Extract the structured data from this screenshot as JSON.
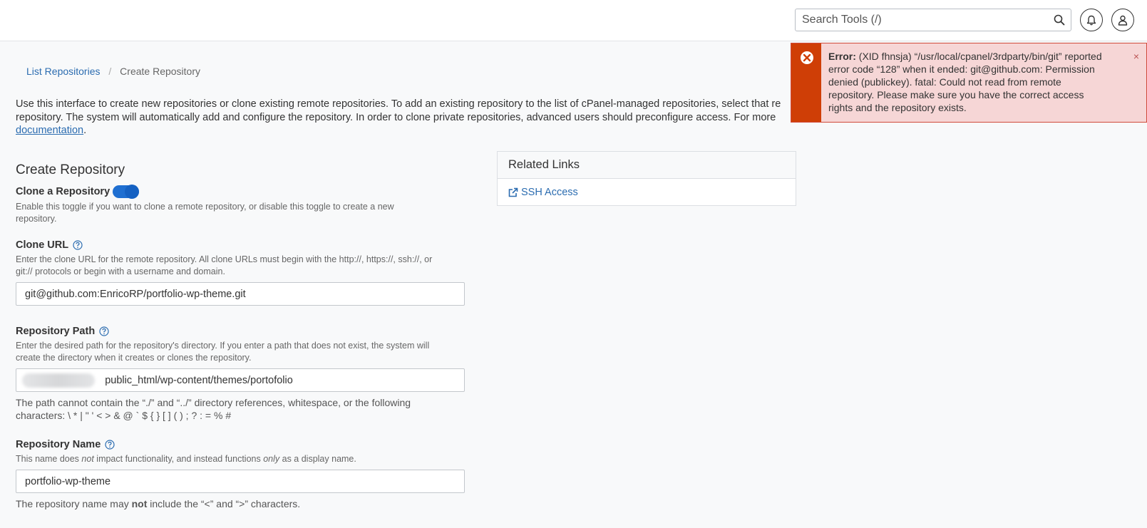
{
  "header": {
    "search_placeholder": "Search Tools (/)",
    "icons": [
      "search-icon",
      "bell-icon",
      "user-icon"
    ]
  },
  "breadcrumb": {
    "link": "List Repositories",
    "separator": "/",
    "current": "Create Repository"
  },
  "intro": {
    "line1": "Use this interface to create new repositories or clone existing remote repositories. To add an existing repository to the list of cPanel-managed repositories, select that re",
    "line2": "repository. The system will automatically add and configure the repository. In order to clone private repositories, advanced users should preconfigure access. For more",
    "link": "documentation",
    "after_link": "."
  },
  "form": {
    "title": "Create Repository",
    "clone_toggle": {
      "label": "Clone a Repository",
      "enabled": true,
      "desc_line1": "Enable this toggle if you want to clone a remote repository, or disable this toggle to create a new",
      "desc_line2": "repository."
    },
    "clone_url": {
      "label": "Clone URL",
      "desc_line1": "Enter the clone URL for the remote repository. All clone URLs must begin with the http://, https://, ssh://, or",
      "desc_line2": "git:// protocols or begin with a username and domain.",
      "value": "git@github.com:EnricoRP/portfolio-wp-theme.git"
    },
    "repo_path": {
      "label": "Repository Path",
      "desc_line1": "Enter the desired path for the repository's directory. If you enter a path that does not exist, the system will",
      "desc_line2": "create the directory when it creates or clones the repository.",
      "value": "public_html/wp-content/themes/portofolio",
      "note_line1": "The path cannot contain the “./” and “../” directory references, whitespace, or the following",
      "note_line2": "characters: \\ * | \" ' < > & @ ` $ { } [ ] ( ) ; ? : = % #"
    },
    "repo_name": {
      "label": "Repository Name",
      "desc_pre": "This name does ",
      "desc_em1": "not",
      "desc_mid": " impact functionality, and instead functions ",
      "desc_em2": "only",
      "desc_post": " as a display name.",
      "value": "portfolio-wp-theme",
      "note_pre": "The repository name may ",
      "note_bold": "not",
      "note_post": " include the “<” and “>” characters."
    }
  },
  "related_links": {
    "title": "Related Links",
    "items": [
      {
        "label": "SSH Access",
        "icon": "external-link-icon"
      }
    ]
  },
  "alert": {
    "prefix": "Error:",
    "message": " (XID fhnsja) “/usr/local/cpanel/3rdparty/bin/git” reported error code “128” when it ended: git@github.com: Permission denied (publickey). fatal: Could not read from remote repository. Please make sure you have the correct access rights and the repository exists.",
    "close": "×",
    "colors": {
      "side": "#cf3e06",
      "background": "#f6d6d6",
      "border": "#d04a3a"
    }
  },
  "colors": {
    "link": "#2b6cb0",
    "toggle": "#1f6fd1"
  }
}
